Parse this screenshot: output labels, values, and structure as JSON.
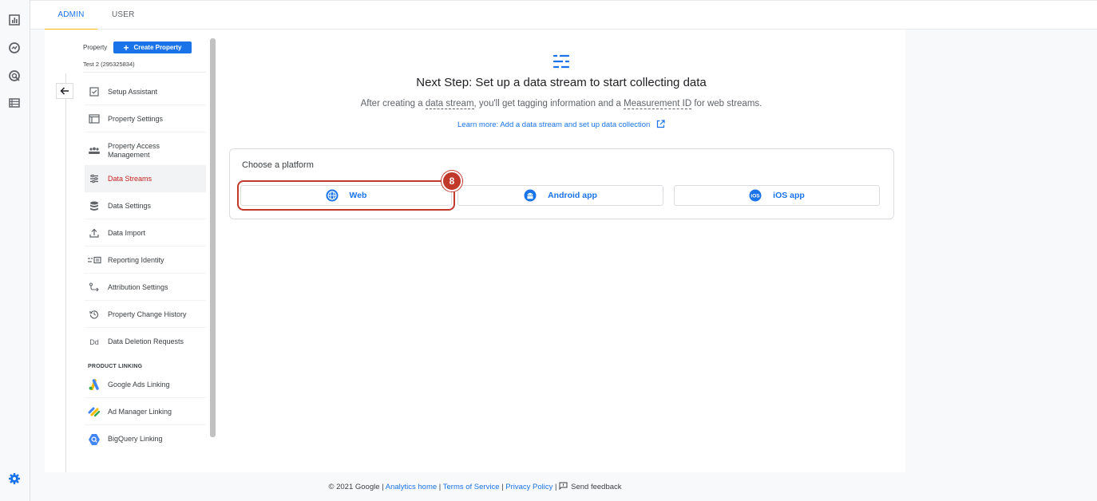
{
  "tabs": [
    {
      "label": "ADMIN",
      "active": true
    },
    {
      "label": "USER",
      "active": false
    }
  ],
  "rail_icons": [
    "reports-icon",
    "explore-icon",
    "advertising-icon",
    "configure-icon",
    "settings-gear-icon"
  ],
  "sidebar": {
    "property_label": "Property",
    "create_button": "Create Property",
    "property_name": "Test 2 (295325834)",
    "items": [
      {
        "label": "Setup Assistant",
        "icon": "checkbox-icon"
      },
      {
        "label": "Property Settings",
        "icon": "window-icon"
      },
      {
        "label": "Property Access\nManagement",
        "icon": "people-icon"
      },
      {
        "label": "Data Streams",
        "icon": "streams-icon",
        "active": true
      },
      {
        "label": "Data Settings",
        "icon": "database-icon"
      },
      {
        "label": "Data Import",
        "icon": "upload-icon"
      },
      {
        "label": "Reporting Identity",
        "icon": "identity-icon"
      },
      {
        "label": "Attribution Settings",
        "icon": "attribution-icon"
      },
      {
        "label": "Property Change History",
        "icon": "history-icon"
      },
      {
        "label": "Data Deletion Requests",
        "icon": "dd-icon"
      }
    ],
    "section_title": "PRODUCT LINKING",
    "linking": [
      {
        "label": "Google Ads Linking",
        "icon": "google-ads-icon"
      },
      {
        "label": "Ad Manager Linking",
        "icon": "ad-manager-icon"
      },
      {
        "label": "BigQuery Linking",
        "icon": "bigquery-icon"
      }
    ]
  },
  "main": {
    "headline": "Next Step: Set up a data stream to start collecting data",
    "sub_prefix": "After creating a ",
    "sub_term1": "data stream",
    "sub_mid": ", you'll get tagging information and a ",
    "sub_term2": "Measurement ID",
    "sub_suffix": " for web streams.",
    "learn_more": "Learn more: Add a data stream and set up data collection",
    "card_title": "Choose a platform",
    "platforms": [
      {
        "label": "Web",
        "icon": "globe-icon"
      },
      {
        "label": "Android app",
        "icon": "android-icon"
      },
      {
        "label": "iOS app",
        "icon": "ios-icon"
      }
    ],
    "step_badge": "8",
    "colors": {
      "accent": "#1a73e8",
      "highlight": "#c0392b",
      "active_nav": "#c5221f"
    }
  },
  "footer": {
    "copyright": "© 2021 Google",
    "sep": " | ",
    "links": [
      "Analytics home",
      "Terms of Service",
      "Privacy Policy"
    ],
    "feedback": "Send feedback"
  }
}
